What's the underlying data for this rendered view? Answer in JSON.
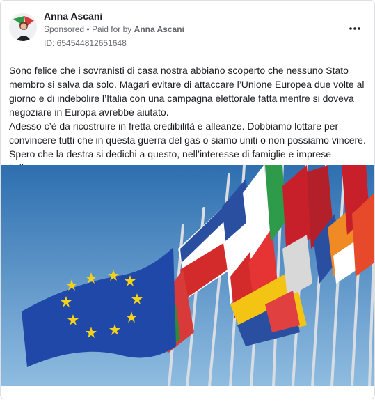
{
  "post": {
    "author": "Anna Ascani",
    "sponsored_label": "Sponsored",
    "separator": "•",
    "paid_for_prefix": "Paid for by",
    "paid_for_by": "Anna Ascani",
    "ad_id": "ID: 654544812651648",
    "more_icon": "more-horizontal-icon",
    "text_paragraphs": [
      "Sono felice che i sovranisti di casa nostra abbiano scoperto che nessuno Stato membro si salva da solo. Magari evitare di attaccare l’Unione Europea due volte al giorno e di indebolire l’Italia con una campagna elettorale fatta mentre si doveva negoziare in Europa avrebbe aiutato.",
      "Adesso c’è da ricostruire in fretta credibilità e alleanze. Dobbiamo lottare per convincere tutti che in questa guerra del gas o siamo uniti o non possiamo vincere. Spero che la destra si dedichi a questo, nell’interesse di famiglie e imprese italian..."
    ]
  },
  "colors": {
    "sky": "#5b95c9",
    "eu_blue": "#1f48a8",
    "eu_star": "#f6d11a",
    "text": "#1c1e21",
    "meta": "#65676b"
  }
}
